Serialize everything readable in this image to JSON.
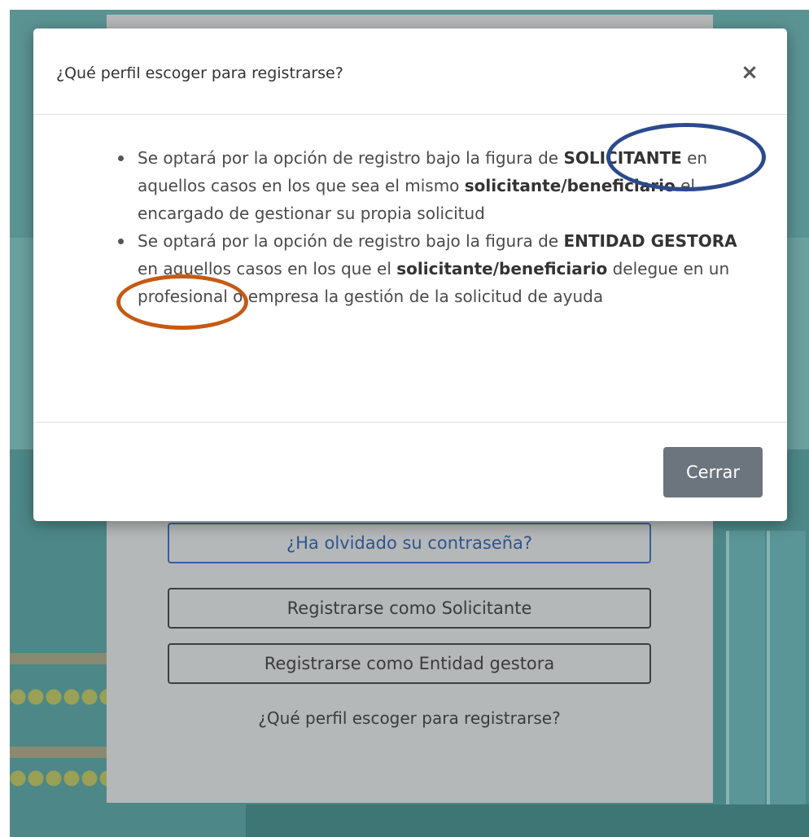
{
  "background": {
    "forgot_password": "¿Ha olvidado su contraseña?",
    "register_applicant": "Registrarse como Solicitante",
    "register_entity": "Registrarse como Entidad gestora",
    "profile_link": "¿Qué perfil escoger para registrarse?"
  },
  "modal": {
    "title": "¿Qué perfil escoger para registrarse?",
    "close_symbol": "×",
    "bullet1": {
      "t1": "Se optará por la opción de registro bajo la figura de ",
      "b1": "SOLICITANTE",
      "t2": " en aquellos casos en los que sea el mismo ",
      "b2": "solicitante/beneficiario",
      "t3": " el encargado de gestionar su propia solicitud"
    },
    "bullet2": {
      "t1": "Se optará por la opción de registro bajo la figura de ",
      "b1": "ENTIDAD GESTORA",
      "t2": " en aquellos casos en los que el ",
      "b2": "solicitante/beneficiario",
      "t3": " delegue en un profesional o empresa la gestión de la solicitud de ayuda"
    },
    "close_button": "Cerrar"
  },
  "colors": {
    "annotation_blue": "#2c4a8c",
    "annotation_orange": "#c55a14",
    "button_secondary": "#6c757d"
  }
}
